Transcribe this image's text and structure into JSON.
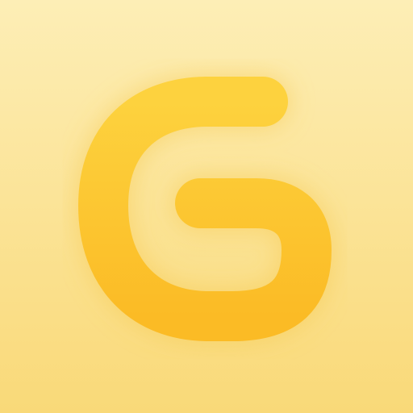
{
  "icon": {
    "name": "letter-g-logo-icon",
    "glyph": "G",
    "colors": {
      "background_top": "#fdeeb6",
      "background_bottom": "#f9d978",
      "glyph_top": "#fdd23e",
      "glyph_bottom": "#fbbb25",
      "glow": "#f6c84a"
    }
  }
}
